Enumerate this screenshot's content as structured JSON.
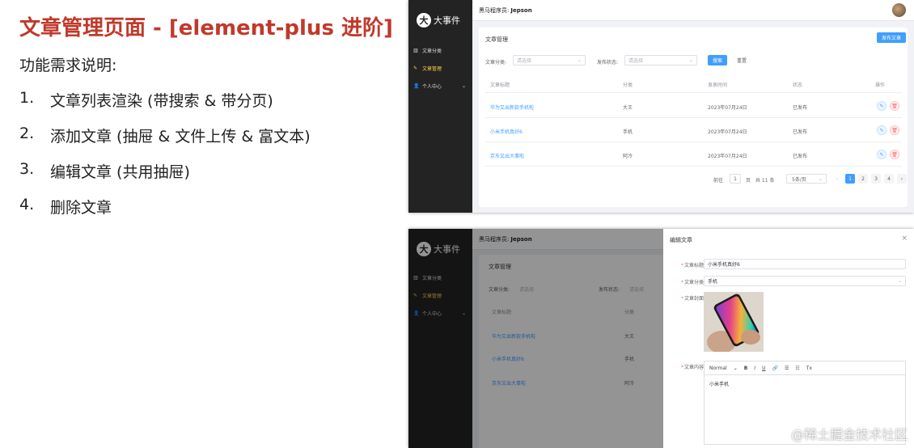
{
  "slide": {
    "title": "文章管理页面 - [element-plus 进阶]",
    "req_heading": "功能需求说明:",
    "requirements": [
      {
        "num": "1.",
        "text": "文章列表渲染 (带搜索 & 带分页)"
      },
      {
        "num": "2.",
        "text": "添加文章 (抽屉 & 文件上传 & 富文本)"
      },
      {
        "num": "3.",
        "text": "编辑文章 (共用抽屉)"
      },
      {
        "num": "4.",
        "text": "删除文章"
      }
    ]
  },
  "app": {
    "logo_text": "大事件",
    "menu": [
      {
        "label": "文章分类",
        "icon": "▥"
      },
      {
        "label": "文章管理",
        "icon": "✎"
      },
      {
        "label": "个人中心",
        "icon": "👤",
        "arrow": "⌄"
      }
    ],
    "header_prefix": "黑马程序员:",
    "header_user": "Jepson",
    "page_title": "文章管理",
    "add_button": "发布文章",
    "filter": {
      "category_label": "文章分类:",
      "category_placeholder": "请选择",
      "state_label": "发布状态:",
      "state_placeholder": "请选择",
      "search_button": "搜索",
      "reset_button": "重置"
    },
    "table": {
      "headers": [
        "文章标题",
        "分类",
        "发表时间",
        "状态",
        "操作"
      ],
      "rows": [
        {
          "title": "华为又出新款手机啦",
          "category": "大王",
          "time": "2023年07月24日",
          "state": "已发布"
        },
        {
          "title": "小米手机真好6",
          "category": "手机",
          "time": "2023年07月24日",
          "state": "已发布"
        },
        {
          "title": "京东又出大事啦",
          "category": "阿冷",
          "time": "2023年07月24日",
          "state": "已发布"
        }
      ]
    },
    "pagination": {
      "goto_label": "前往",
      "goto_value": "1",
      "page_suffix": "页",
      "total": "共 11 条",
      "size": "5条/页",
      "prev": "‹",
      "next": "›",
      "pages": [
        "1",
        "2",
        "3",
        "4"
      ]
    }
  },
  "drawer": {
    "title": "编辑文章",
    "close": "×",
    "fields": {
      "title_label": "文章标题",
      "title_value": "小米手机真好6",
      "category_label": "文章分类",
      "category_value": "手机",
      "cover_label": "文章封面",
      "content_label": "文章内容"
    },
    "toolbar": [
      "Normal",
      "⌄",
      "B",
      "I",
      "U",
      "🔗",
      "☰",
      "☷",
      "Tx"
    ],
    "content": "小米手机"
  },
  "watermark": "@稀土掘金技术社区",
  "colors": {
    "title_red": "#c0392b",
    "primary": "#409eff",
    "sidebar": "#232323",
    "active_menu": "#ffd04b"
  }
}
